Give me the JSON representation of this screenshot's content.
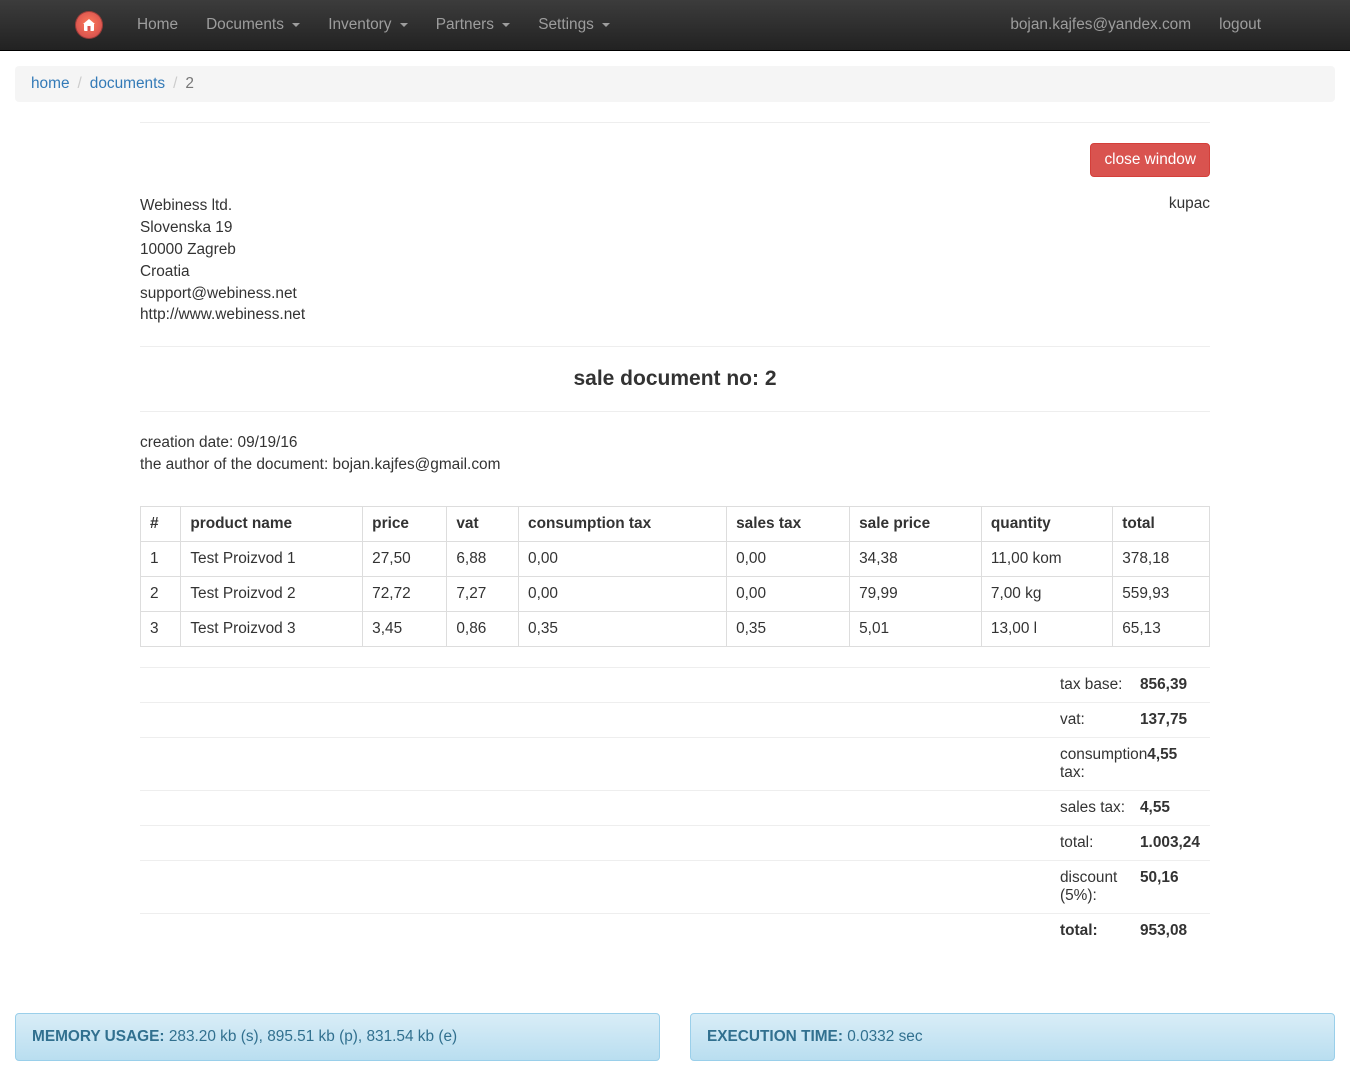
{
  "nav": {
    "home": "Home",
    "documents": "Documents",
    "inventory": "Inventory",
    "partners": "Partners",
    "settings": "Settings",
    "user": "bojan.kajfes@yandex.com",
    "logout": "logout"
  },
  "breadcrumb": {
    "home": "home",
    "documents": "documents",
    "current": "2"
  },
  "buttons": {
    "close_window": "close window"
  },
  "company": {
    "name": "Webiness ltd.",
    "street": "Slovenska 19",
    "city": "10000 Zagreb",
    "country": "Croatia",
    "email": "support@webiness.net",
    "url": "http://www.webiness.net"
  },
  "buyer_label": "kupac",
  "doc_title": "sale document no: 2",
  "meta": {
    "creation_label": "creation date: ",
    "creation_value": "09/19/16",
    "author_label": "the author of the document: ",
    "author_value": "bojan.kajfes@gmail.com"
  },
  "table": {
    "headers": {
      "idx": "#",
      "name": "product name",
      "price": "price",
      "vat": "vat",
      "cons_tax": "consumption tax",
      "sales_tax": "sales tax",
      "sale_price": "sale price",
      "quantity": "quantity",
      "total": "total"
    },
    "rows": [
      {
        "idx": "1",
        "name": "Test Proizvod 1",
        "price": "27,50",
        "vat": "6,88",
        "cons_tax": "0,00",
        "sales_tax": "0,00",
        "sale_price": "34,38",
        "quantity": "11,00 kom",
        "total": "378,18"
      },
      {
        "idx": "2",
        "name": "Test Proizvod 2",
        "price": "72,72",
        "vat": "7,27",
        "cons_tax": "0,00",
        "sales_tax": "0,00",
        "sale_price": "79,99",
        "quantity": "7,00 kg",
        "total": "559,93"
      },
      {
        "idx": "3",
        "name": "Test Proizvod 3",
        "price": "3,45",
        "vat": "0,86",
        "cons_tax": "0,35",
        "sales_tax": "0,35",
        "sale_price": "5,01",
        "quantity": "13,00 l",
        "total": "65,13"
      }
    ]
  },
  "totals": {
    "tax_base_label": "tax base:",
    "tax_base_value": "856,39",
    "vat_label": "vat:",
    "vat_value": "137,75",
    "cons_tax_label": "consumption tax:",
    "cons_tax_value": "4,55",
    "sales_tax_label": "sales tax:",
    "sales_tax_value": "4,55",
    "subtotal_label": "total:",
    "subtotal_value": "1.003,24",
    "discount_label": "discount (5%):",
    "discount_value": "50,16",
    "final_label": "total:",
    "final_value": "953,08"
  },
  "footer": {
    "mem_label": "MEMORY USAGE:",
    "mem_value": " 283.20 kb (s), 895.51 kb (p), 831.54 kb (e)",
    "exec_label": "EXECUTION TIME:",
    "exec_value": " 0.0332 sec"
  }
}
